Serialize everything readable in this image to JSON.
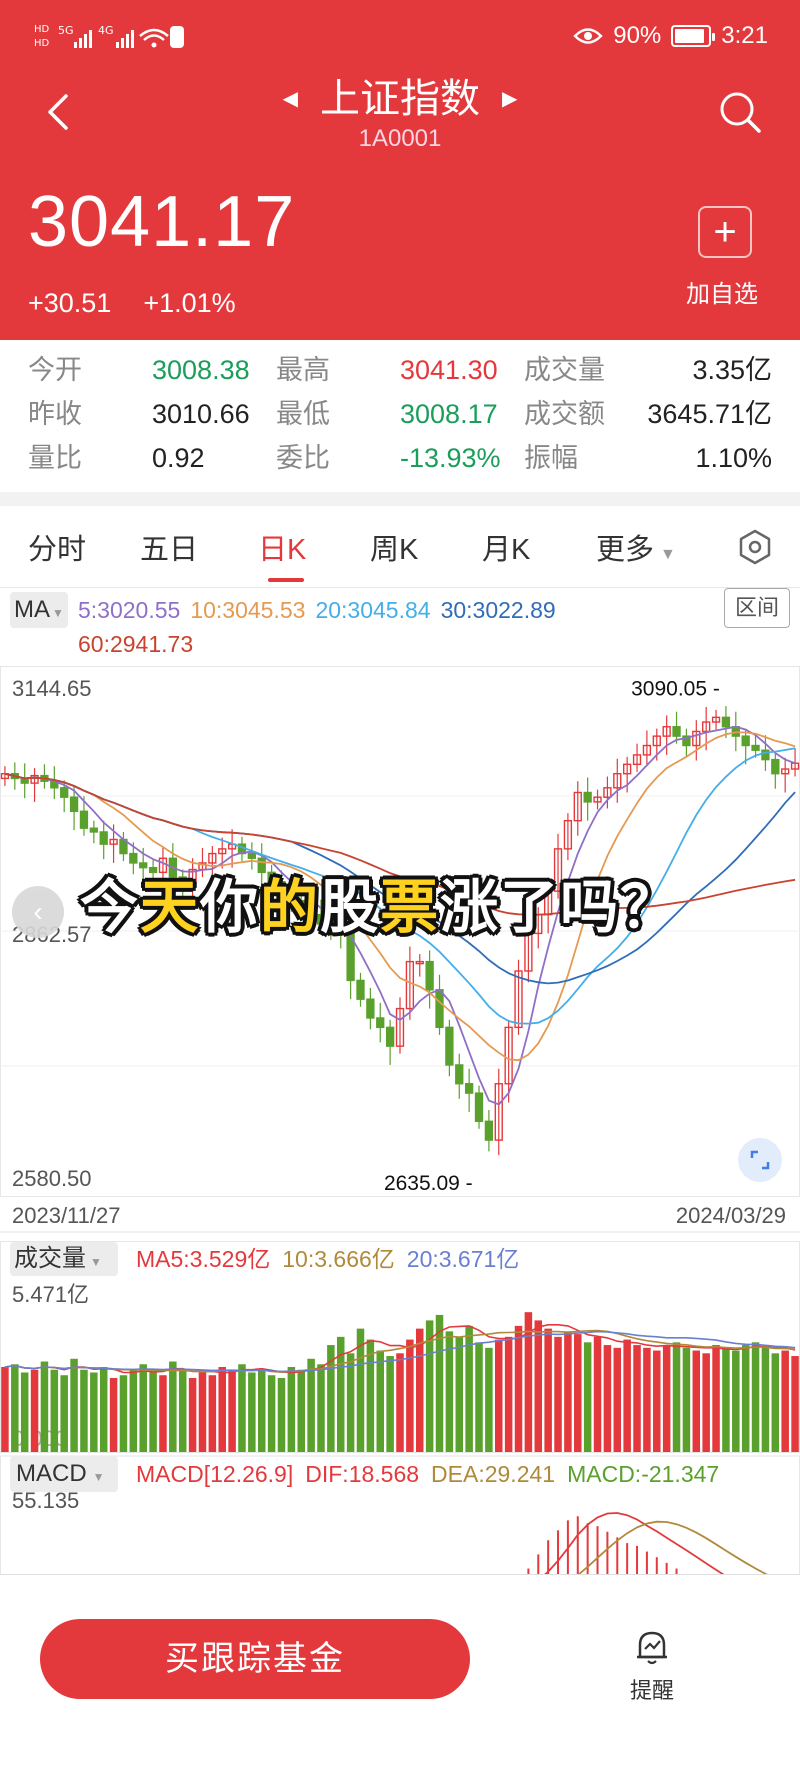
{
  "status_bar": {
    "network_left": "HD 5G 4G",
    "battery_pct": "90%",
    "time": "3:21",
    "battery_level": 0.9
  },
  "header": {
    "title": "上证指数",
    "code": "1A0001",
    "price": "3041.17",
    "change": "+30.51",
    "change_pct": "+1.01%",
    "add_watch": "加自选"
  },
  "quote": {
    "open_label": "今开",
    "open": "3008.38",
    "high_label": "最高",
    "high": "3041.30",
    "volume_label": "成交量",
    "volume": "3.35亿",
    "prev_close_label": "昨收",
    "prev_close": "3010.66",
    "low_label": "最低",
    "low": "3008.17",
    "amount_label": "成交额",
    "amount": "3645.71亿",
    "vol_ratio_label": "量比",
    "vol_ratio": "0.92",
    "commission_label": "委比",
    "commission": "-13.93%",
    "amplitude_label": "振幅",
    "amplitude": "1.10%"
  },
  "tabs": [
    {
      "label": "分时"
    },
    {
      "label": "五日"
    },
    {
      "label": "日K",
      "active": true
    },
    {
      "label": "周K"
    },
    {
      "label": "月K"
    },
    {
      "label": "更多"
    }
  ],
  "ma": {
    "badge": "MA",
    "ma5": "5:3020.55",
    "ma10": "10:3045.53",
    "ma20": "20:3045.84",
    "ma30": "30:3022.89",
    "ma60": "60:2941.73",
    "range": "区间"
  },
  "colors": {
    "up": "#e4393c",
    "down": "#5aa02c",
    "ma5": "#8f6fc8",
    "ma10": "#e59a52",
    "ma20": "#44aee8",
    "ma30": "#2f6db8",
    "ma60": "#c8442f",
    "accent": "#e4393c"
  },
  "chart_data": {
    "type": "candlestick",
    "y_max_label": "3144.65",
    "y_mid_label": "2862.57",
    "y_min_label": "2580.50",
    "ylim": [
      2580.5,
      3144.65
    ],
    "x_start": "2023/11/27",
    "x_end": "2024/03/29",
    "high_mark": "3090.05",
    "low_mark": "2635.09",
    "close_series": [
      3030,
      3025,
      3020,
      3028,
      3022,
      3015,
      3005,
      2990,
      2972,
      2968,
      2955,
      2960,
      2945,
      2935,
      2930,
      2925,
      2940,
      2920,
      2915,
      2928,
      2935,
      2945,
      2950,
      2955,
      2945,
      2940,
      2925,
      2915,
      2900,
      2895,
      2890,
      2880,
      2870,
      2865,
      2860,
      2810,
      2790,
      2770,
      2760,
      2740,
      2780,
      2830,
      2830,
      2800,
      2760,
      2720,
      2700,
      2690,
      2660,
      2640,
      2700,
      2760,
      2820,
      2860,
      2880,
      2905,
      2950,
      2980,
      3010,
      3000,
      3005,
      3015,
      3030,
      3040,
      3050,
      3060,
      3070,
      3080,
      3070,
      3060,
      3075,
      3085,
      3090,
      3080,
      3070,
      3060,
      3055,
      3045,
      3030,
      3035,
      3041.17
    ],
    "volume": {
      "badge": "成交量",
      "ma5": "MA5:3.529亿",
      "ma10": "10:3.666亿",
      "ma20": "20:3.671亿",
      "max_label": "5.471亿",
      "min_label": "0.000",
      "values": [
        3.1,
        3.2,
        2.9,
        3.0,
        3.3,
        3.0,
        2.8,
        3.4,
        3.0,
        2.9,
        3.1,
        2.7,
        2.8,
        3.0,
        3.2,
        2.9,
        2.8,
        3.3,
        3.0,
        2.7,
        2.9,
        2.8,
        3.1,
        3.0,
        3.2,
        2.9,
        3.0,
        2.8,
        2.7,
        3.1,
        3.0,
        3.4,
        3.2,
        3.9,
        4.2,
        3.6,
        4.5,
        4.1,
        3.7,
        3.5,
        3.6,
        4.1,
        4.5,
        4.8,
        5.0,
        4.4,
        4.2,
        4.6,
        4.0,
        3.8,
        4.1,
        4.2,
        4.6,
        5.1,
        4.8,
        4.5,
        4.2,
        4.4,
        4.3,
        4.0,
        4.2,
        3.9,
        3.8,
        4.1,
        3.9,
        3.8,
        3.7,
        3.9,
        4.0,
        3.8,
        3.7,
        3.6,
        3.9,
        3.8,
        3.7,
        3.9,
        4.0,
        3.8,
        3.6,
        3.7,
        3.5
      ]
    },
    "macd": {
      "badge": "MACD",
      "params": "MACD[12.26.9]",
      "dif": "DIF:18.568",
      "dea": "DEA:29.241",
      "macd": "MACD:-21.347",
      "max_label": "55.135",
      "values": [
        0,
        0,
        0,
        0,
        0,
        0,
        0,
        0,
        0,
        0,
        0,
        0,
        0,
        0,
        0,
        0,
        0,
        0,
        0,
        0,
        0,
        0,
        0,
        0,
        -8,
        -10,
        -12,
        -10,
        -6,
        -3,
        0,
        0,
        0,
        0,
        0,
        0,
        0,
        0,
        0,
        0,
        0,
        0,
        0,
        -6,
        -8,
        -10,
        -6,
        -2,
        0,
        0,
        0,
        0,
        8,
        18,
        28,
        38,
        45,
        52,
        55,
        50,
        48,
        44,
        40,
        36,
        34,
        30,
        26,
        22,
        18,
        14,
        10,
        6,
        4,
        0,
        0,
        0,
        0,
        0,
        0,
        -4,
        -6
      ]
    }
  },
  "overlay": {
    "part1": "今",
    "part2": "天",
    "part3": "你",
    "part4": "的",
    "part5": "股",
    "part6": "票",
    "part7": "涨了吗？"
  },
  "bottom": {
    "buy_label": "买跟踪基金",
    "remind_label": "提醒"
  }
}
